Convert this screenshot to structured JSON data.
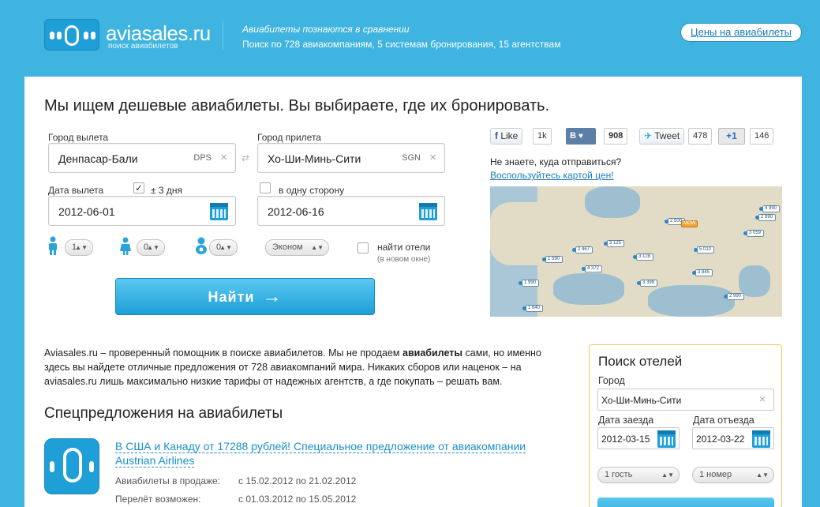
{
  "header": {
    "logo_text": "aviasales.ru",
    "logo_sub": "поиск авиабилетов",
    "tagline": "Авиабилеты познаются в сравнении",
    "tagline2": "Поиск по 728 авиакомпаниям, 5 системам бронирования, 15 агентствам",
    "prices_link": "Цены на авиабилеты"
  },
  "search": {
    "headline": "Мы ищем дешевые авиабилеты. Вы выбираете, где их бронировать.",
    "from_label": "Город вылета",
    "from_value": "Денпасар-Бали",
    "from_code": "DPS",
    "to_label": "Город прилета",
    "to_value": "Хо-Ши-Минь-Сити",
    "to_code": "SGN",
    "depart_label": "Дата вылета",
    "flex_label": "± 3 дня",
    "depart_value": "2012-06-01",
    "oneway_label": "в одну сторону",
    "return_value": "2012-06-16",
    "adults": "1",
    "children": "0",
    "infants": "0",
    "class_value": "Эконом",
    "hotels_label": "найти отели",
    "hotels_note": "(в новом окне)",
    "search_button": "Найти",
    "clear_symbol": "×",
    "swap_symbol": "⇄",
    "check_symbol": "✓",
    "arrow_symbol": "→",
    "select_arrow": "▲▼"
  },
  "social": {
    "fb_label": "Like",
    "fb_count": "1k",
    "vk_label": "В",
    "vk_count": "908",
    "tw_label": "Tweet",
    "tw_count": "478",
    "gp_label": "+1",
    "gp_count": "146"
  },
  "map_promo": {
    "question": "Не знаете, куда отправиться?",
    "link": "Воспользуйтесь картой цен!",
    "pins": [
      "4 990",
      "2 990",
      "3 059",
      "3 125",
      "3 845",
      "5 010",
      "2 467",
      "1 590",
      "4 372",
      "3 128",
      "1 990",
      "3 399",
      "2 990",
      "1 640",
      "2 500",
      "MOW"
    ]
  },
  "about": {
    "text_before": "Aviasales.ru – проверенный помощник в поиске авиабилетов. Мы не продаем ",
    "text_bold": "авиабилеты",
    "text_after": " сами, но именно здесь вы найдете отличные предложения от 728 авиакомпаний мира. Никаких сборов или наценок – на aviasales.ru лишь максимально низкие тарифы от надежных агентств, а где покупать – решать вам."
  },
  "specials": {
    "title": "Спецпредложения на авиабилеты",
    "offer_link": "В США и Канаду от 17288 рублей! Специальное предложение от авиакомпании Austrian Airlines",
    "sale_label": "Авиабилеты в продаже:",
    "sale_value": "с 15.02.2012 по 21.02.2012",
    "travel_label": "Перелёт возможен:",
    "travel_value": "с 01.03.2012 по 15.05.2012"
  },
  "hotels": {
    "title": "Поиск отелей",
    "city_label": "Город",
    "city_value": "Хо-Ши-Минь-Сити",
    "checkin_label": "Дата заезда",
    "checkin_value": "2012-03-15",
    "checkout_label": "Дата отъезда",
    "checkout_value": "2012-03-22",
    "guests": "1 гость",
    "rooms": "1 номер"
  }
}
